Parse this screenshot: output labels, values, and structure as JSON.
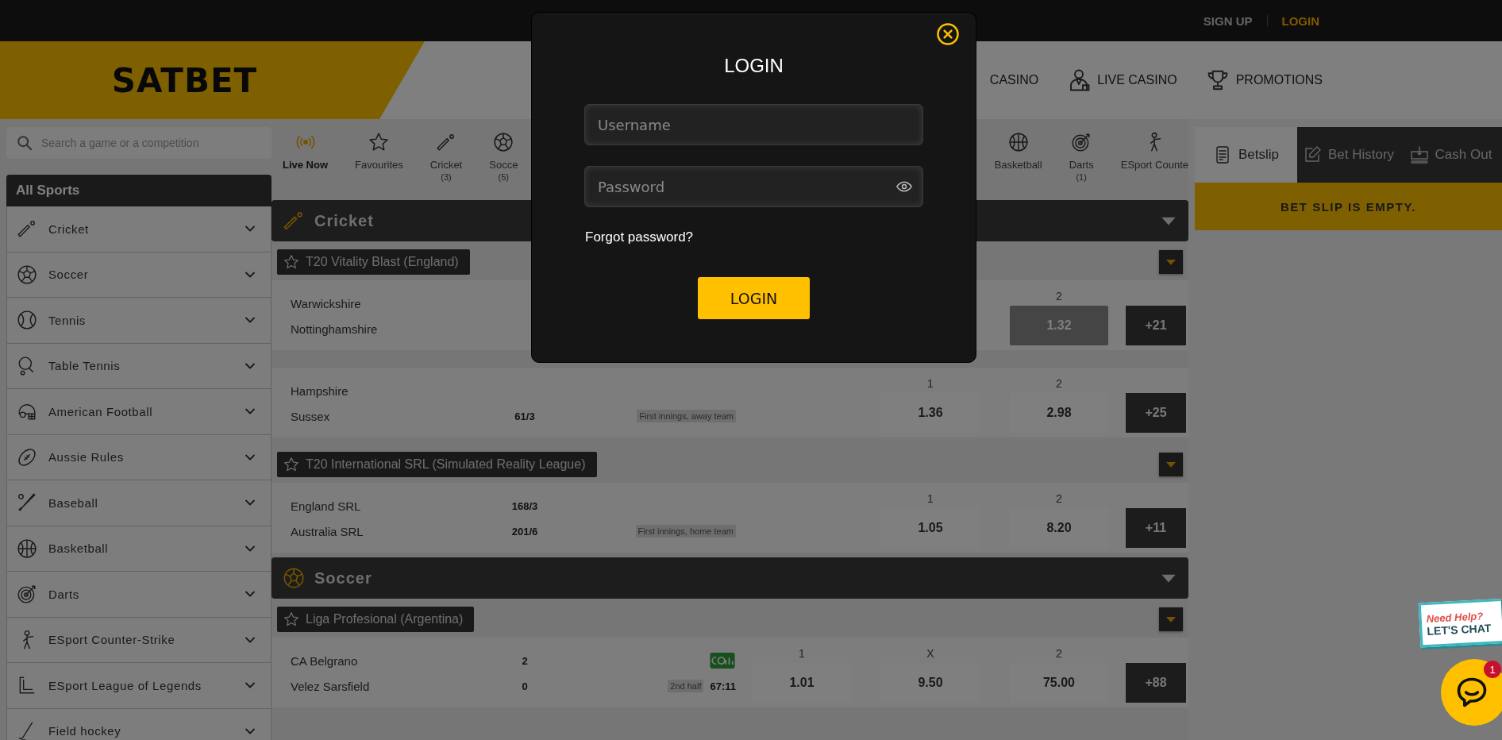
{
  "top_bar": {
    "links": [
      {
        "label": "SIGN UP",
        "highlighted": false
      },
      {
        "label": "LOGIN",
        "highlighted": true
      }
    ]
  },
  "header": {
    "logo": "SATBET",
    "nav": [
      {
        "label": "CASINO"
      },
      {
        "label": "LIVE CASINO"
      },
      {
        "label": "PROMOTIONS"
      }
    ]
  },
  "sidebar": {
    "search": {
      "placeholder": "Search a game or a competition"
    },
    "title": "All Sports",
    "items": [
      {
        "label": "Cricket",
        "expanded": false
      },
      {
        "label": "Soccer",
        "expanded": false
      },
      {
        "label": "Tennis",
        "expanded": false
      },
      {
        "label": "Table Tennis",
        "expanded": false
      },
      {
        "label": "American Football",
        "expanded": false
      },
      {
        "label": "Aussie Rules",
        "expanded": false
      },
      {
        "label": "Baseball",
        "expanded": false
      },
      {
        "label": "Basketball",
        "expanded": false
      },
      {
        "label": "Darts",
        "expanded": false
      },
      {
        "label": "ESport Counter-Strike",
        "expanded": false
      },
      {
        "label": "ESport League of Legends",
        "expanded": false
      },
      {
        "label": "Field hockey",
        "expanded": false
      }
    ]
  },
  "sport_tabs": [
    {
      "label": "Live Now",
      "selected": true
    },
    {
      "label": "Favourites",
      "selected": false
    },
    {
      "label": "Cricket",
      "count": "(3)",
      "selected": false
    },
    {
      "label": "Socce",
      "count": "(5)",
      "selected": false
    },
    {
      "label": "Basketball",
      "selected": false
    },
    {
      "label": "Darts",
      "count": "(1)",
      "selected": false
    },
    {
      "label": "ESport Counte",
      "selected": false
    }
  ],
  "sections": [
    {
      "title": "Cricket",
      "leagues": [
        {
          "name": "T20 Vitality Blast (England)",
          "favourite": false,
          "events": [
            {
              "home": "Warwickshire",
              "away": "Nottinghamshire",
              "odds": [
                {
                  "label": "2",
                  "value": "1.32",
                  "disabled": true
                }
              ],
              "more": "+21"
            },
            {
              "home": "Hampshire",
              "away": "Sussex",
              "away_score": "61/3",
              "info": "First innings, away team",
              "odds": [
                {
                  "label": "1",
                  "value": "1.36",
                  "disabled": false
                },
                {
                  "label": "2",
                  "value": "2.98",
                  "disabled": false
                }
              ],
              "more": "+25"
            }
          ]
        },
        {
          "name": "T20 International SRL (Simulated Reality League)",
          "favourite": false,
          "events": [
            {
              "home": "England SRL",
              "away": "Australia SRL",
              "home_score": "168/3",
              "away_score": "201/6",
              "info": "First innings, home team",
              "odds": [
                {
                  "label": "1",
                  "value": "1.05",
                  "disabled": false
                },
                {
                  "label": "2",
                  "value": "8.20",
                  "disabled": false
                }
              ],
              "more": "+11"
            }
          ]
        }
      ]
    },
    {
      "title": "Soccer",
      "leagues": [
        {
          "name": "Liga Profesional (Argentina)",
          "favourite": false,
          "events": [
            {
              "home": "CA Belgrano",
              "away": "Velez Sarsfield",
              "home_score": "2",
              "away_score": "0",
              "stats_icon": true,
              "period": "2nd half",
              "clock": "67:11",
              "odds": [
                {
                  "label": "1",
                  "value": "1.01",
                  "disabled": false
                },
                {
                  "label": "X",
                  "value": "9.50",
                  "disabled": false
                },
                {
                  "label": "2",
                  "value": "75.00",
                  "disabled": false
                }
              ],
              "more": "+88"
            }
          ]
        }
      ]
    }
  ],
  "betslip": {
    "tabs": [
      {
        "label": "Betslip",
        "selected": true
      },
      {
        "label": "Bet History",
        "selected": false
      },
      {
        "label": "Cash Out",
        "selected": false
      }
    ],
    "message": "BET SLIP IS EMPTY."
  },
  "login_modal": {
    "title": "LOGIN",
    "username": {
      "placeholder": "Username"
    },
    "password": {
      "placeholder": "Password"
    },
    "forgot_link": "Forgot password?",
    "submit": "LOGIN"
  },
  "chat": {
    "sign": [
      "Need Help?",
      "LET'S CHAT"
    ],
    "unread": "1"
  }
}
